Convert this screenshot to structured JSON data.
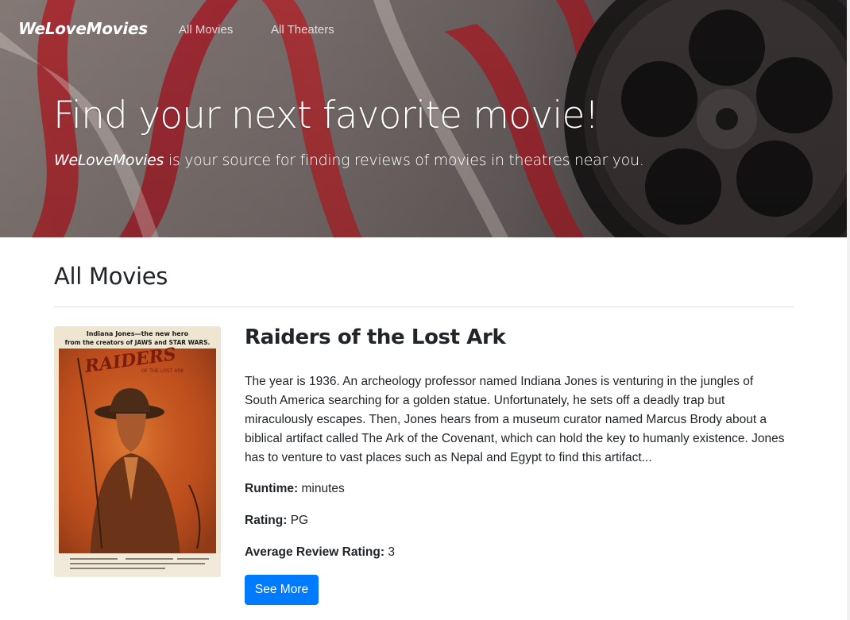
{
  "navbar": {
    "brand": "WeLoveMovies",
    "links": [
      {
        "label": "All Movies"
      },
      {
        "label": "All Theaters"
      }
    ]
  },
  "hero": {
    "title": "Find your next favorite movie!",
    "lead_brand": "WeLoveMovies",
    "lead_text": " is your source for finding reviews of movies in theatres near you."
  },
  "main": {
    "section_title": "All Movies",
    "movies": [
      {
        "title": "Raiders of the Lost Ark",
        "description": "The year is 1936. An archeology professor named Indiana Jones is venturing in the jungles of South America searching for a golden statue. Unfortunately, he sets off a deadly trap but miraculously escapes. Then, Jones hears from a museum curator named Marcus Brody about a biblical artifact called The Ark of the Covenant, which can hold the key to humanly existence. Jones has to venture to vast places such as Nepal and Egypt to find this artifact...",
        "runtime_label": "Runtime:",
        "runtime_value": " minutes",
        "rating_label": "Rating:",
        "rating_value": " PG",
        "avg_label": "Average Review Rating:",
        "avg_value": " 3",
        "button_label": "See More",
        "poster": {
          "tagline_line1": "Indiana Jones—the new hero",
          "tagline_line2": "from the creators of JAWS and STAR WARS.",
          "logo_text": "RAIDERS",
          "logo_sub": "OF THE LOST ARK"
        }
      }
    ]
  },
  "colors": {
    "primary_button": "#007bff",
    "text": "#212529",
    "divider": "#dee2e6"
  }
}
